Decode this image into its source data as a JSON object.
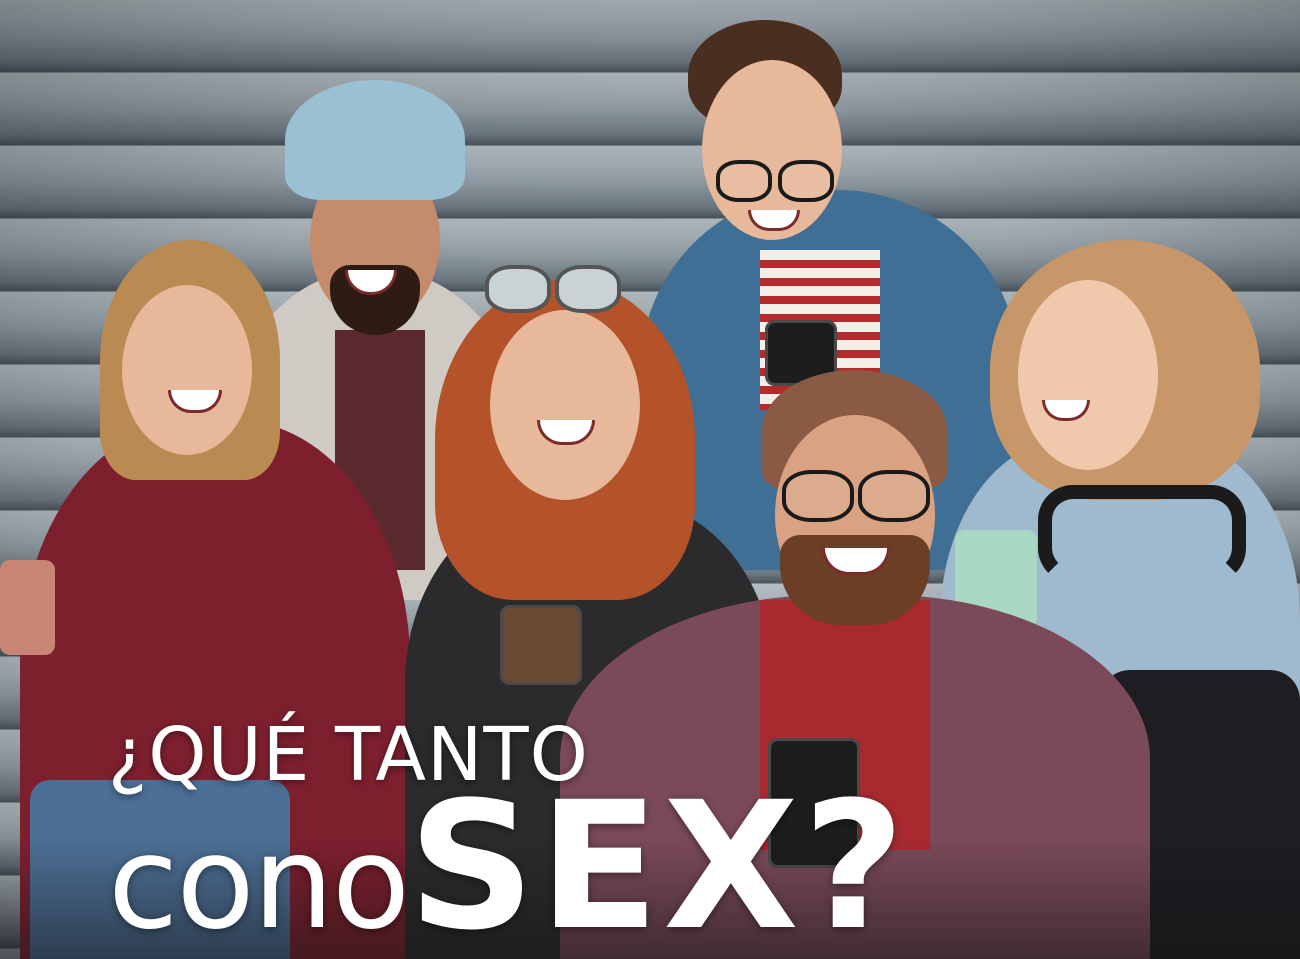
{
  "headline": {
    "line1": "¿QUÉ TANTO",
    "line2_part1": "cono",
    "line2_part2": "SEX?"
  },
  "colors": {
    "text": "#ffffff",
    "background_stairs": "#a9b4bb"
  }
}
